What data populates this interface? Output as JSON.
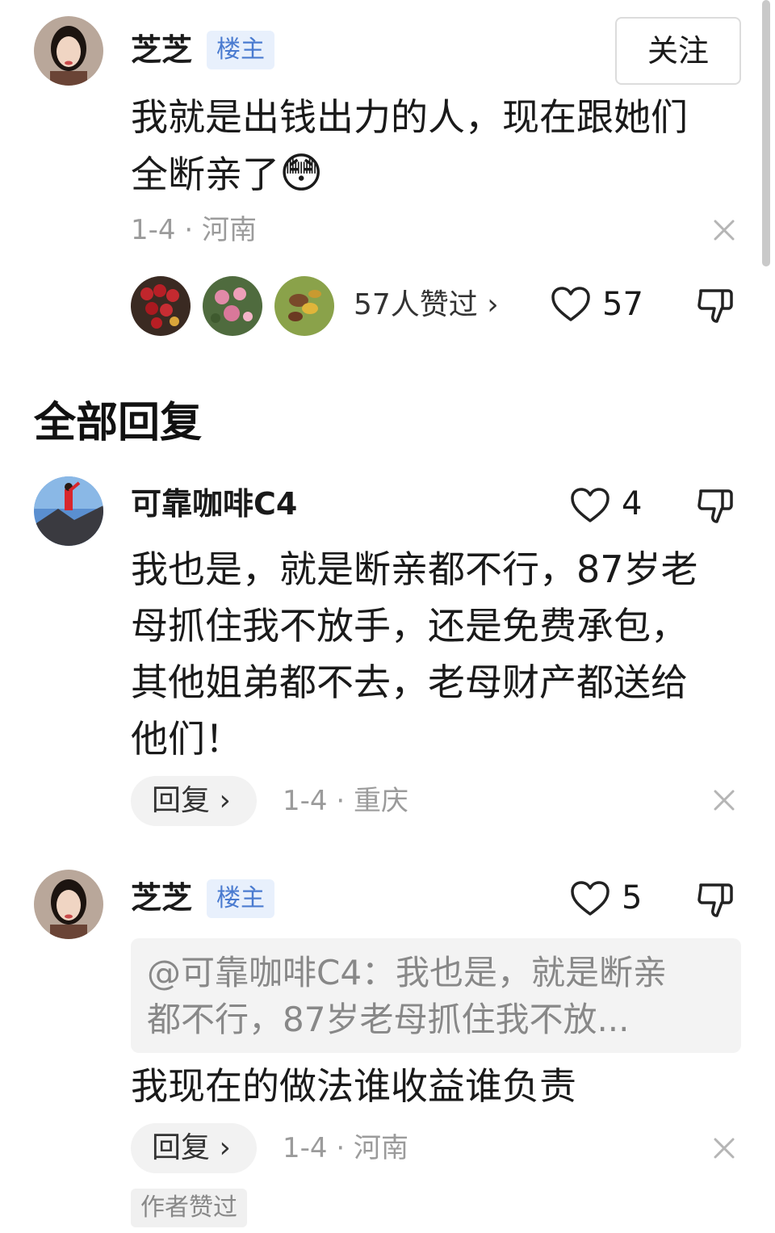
{
  "post": {
    "author": "芝芝",
    "badge": "楼主",
    "follow_label": "关注",
    "content_line1": "我就是出钱出力的人，现在跟她们",
    "content_line2": "全断亲了",
    "emoji": "😳",
    "meta": "1-4 · 河南",
    "likers_label": "57人赞过 ›",
    "like_count": "57"
  },
  "section_title": "全部回复",
  "replies": [
    {
      "author": "可靠咖啡C4",
      "like_count": "4",
      "lines": [
        "我也是，就是断亲都不行，87岁老",
        "母抓住我不放手，还是免费承包，",
        "其他姐弟都不去，老母财产都送给",
        "他们！"
      ],
      "reply_label": "回复 ›",
      "meta": "1-4 · 重庆"
    },
    {
      "author": "芝芝",
      "badge": "楼主",
      "like_count": "5",
      "quote_line1": "@可靠咖啡C4：我也是，就是断亲",
      "quote_line2": "都不行，87岁老母抓住我不放...",
      "text": "我现在的做法谁收益谁负责",
      "reply_label": "回复 ›",
      "meta": "1-4 · 河南",
      "author_liked": "作者赞过"
    }
  ],
  "colors": {
    "badge_bg": "#e8f0fc",
    "badge_text": "#4a7bd0",
    "meta": "#9b9b9b"
  },
  "icons": [
    "heart-icon",
    "thumb-down-icon",
    "close-icon",
    "chevron-right-icon"
  ]
}
